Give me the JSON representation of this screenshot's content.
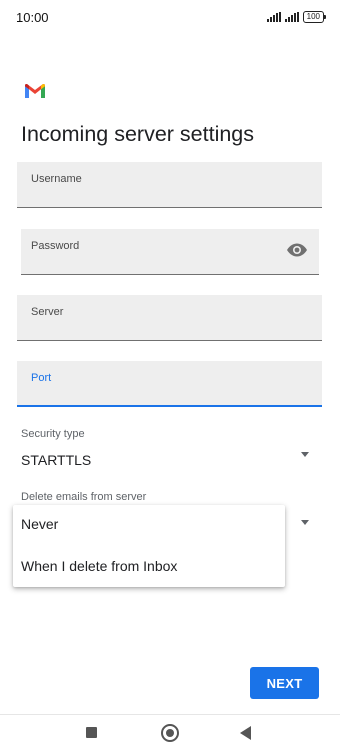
{
  "status_bar": {
    "time": "10:00",
    "battery": "100"
  },
  "app": {
    "logo_icon": "gmail-m-logo",
    "brand_colors": {
      "red": "#EA4335",
      "blue": "#4285F4",
      "green": "#34A853",
      "yellow": "#FBBC04"
    }
  },
  "page": {
    "title": "Incoming server settings"
  },
  "form": {
    "username": {
      "label": "Username",
      "value": ""
    },
    "password": {
      "label": "Password",
      "value": "",
      "toggle_icon": "eye-icon"
    },
    "server": {
      "label": "Server",
      "value": ""
    },
    "port": {
      "label": "Port",
      "value": "",
      "focused": true
    },
    "security_type": {
      "label": "Security type",
      "value": "STARTTLS"
    },
    "delete_emails": {
      "label": "Delete emails from server",
      "options": [
        "Never",
        "When I delete from Inbox"
      ]
    }
  },
  "actions": {
    "next_label": "NEXT"
  },
  "colors": {
    "accent": "#1A73E8",
    "field_bg": "#EEEEEE"
  }
}
